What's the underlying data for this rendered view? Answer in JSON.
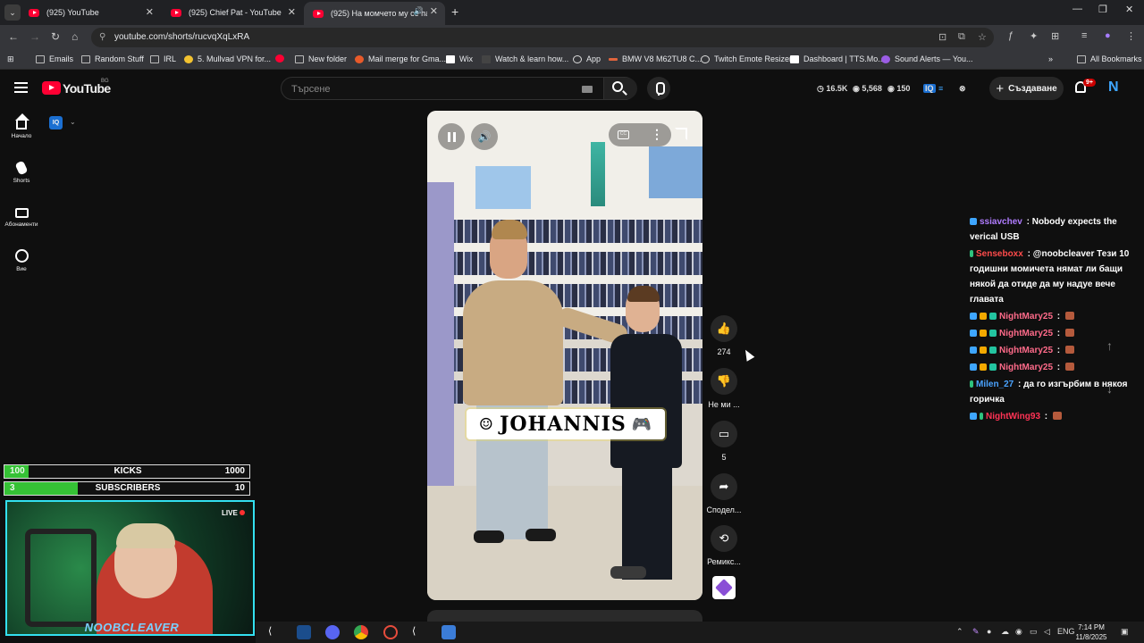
{
  "browser": {
    "tabs": [
      {
        "title": "(925) YouTube"
      },
      {
        "title": "(925) Chief Pat - YouTube"
      },
      {
        "title": "(925) На момчето му се па..."
      }
    ],
    "url": "youtube.com/shorts/rucvqXqLxRA",
    "bookmarks": [
      "Emails",
      "Random Stuff",
      "IRL",
      "5. Mullvad VPN for...",
      "New folder",
      "Mail merge for Gma...",
      "Wix",
      "Watch & learn how...",
      "App",
      "BMW V8 M62TU8 C...",
      "Twitch Emote Resizer",
      "Dashboard | TTS.Mo...",
      "Sound Alerts — You..."
    ],
    "all_bookmarks": "All Bookmarks"
  },
  "youtube": {
    "logo_text": "YouTube",
    "country": "BG",
    "search_placeholder": "Търсене",
    "ext_stats": {
      "views": "16.5K",
      "eye": "5,568",
      "eye2": "150"
    },
    "create_label": "Създаване",
    "notif_badge": "9+",
    "avatar_letter": "N",
    "guide": {
      "home": "Начало",
      "shorts": "Shorts",
      "subs": "Абонаменти",
      "you": "Вие"
    },
    "iq": "IQ"
  },
  "short": {
    "caption": "JOHANNIS",
    "likes": "274",
    "dislike_label": "Не ми ...",
    "comments": "5",
    "share_label": "Сподел...",
    "remix_label": "Ремикс..."
  },
  "chat": [
    {
      "user": "ssiavchev",
      "user_color": "#b07cff",
      "text": "Nobody expects the verical USB"
    },
    {
      "user": "Senseboxx",
      "user_color": "#ff4b4b",
      "text": "@noobcleaver Тези 10 годишни момичета нямат ли бащи някой да отиде да му надуе вече главата"
    },
    {
      "user": "NightMary25",
      "user_color": "#ff6b8a",
      "text": ""
    },
    {
      "user": "NightMary25",
      "user_color": "#ff6b8a",
      "text": ""
    },
    {
      "user": "NightMary25",
      "user_color": "#ff6b8a",
      "text": ""
    },
    {
      "user": "NightMary25",
      "user_color": "#ff6b8a",
      "text": ""
    },
    {
      "user": "Milen_27",
      "user_color": "#4aa3ff",
      "text": "да го изгърбим в някоя горичка"
    },
    {
      "user": "NightWing93",
      "user_color": "#ff3355",
      "text": ""
    }
  ],
  "stream_goals": [
    {
      "current": "100",
      "label": "KICKS",
      "target": "1000",
      "progress": 0.1
    },
    {
      "current": "3",
      "label": "SUBSCRIBERS",
      "target": "10",
      "progress": 0.3
    }
  ],
  "webcam": {
    "live": "LIVE",
    "name": "NOOBCLEAVER"
  },
  "taskbar": {
    "lang": "ENG",
    "time": "7:14 PM",
    "date": "11/8/2025"
  }
}
